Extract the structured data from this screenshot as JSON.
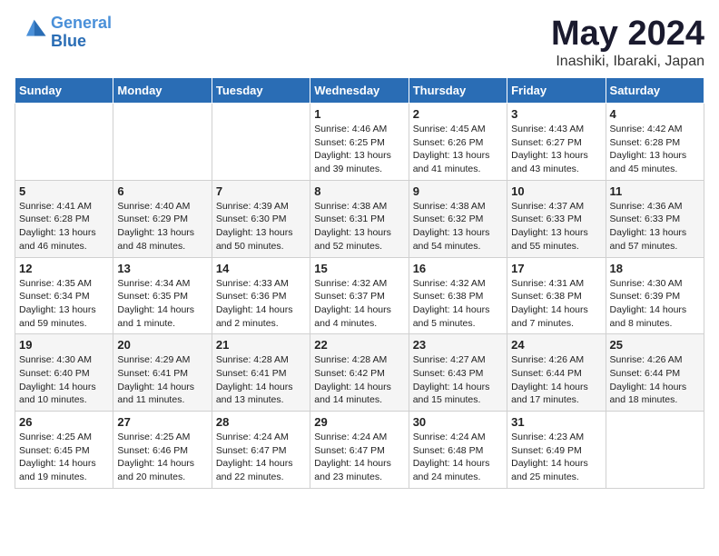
{
  "logo": {
    "line1": "General",
    "line2": "Blue"
  },
  "title": "May 2024",
  "location": "Inashiki, Ibaraki, Japan",
  "days_header": [
    "Sunday",
    "Monday",
    "Tuesday",
    "Wednesday",
    "Thursday",
    "Friday",
    "Saturday"
  ],
  "weeks": [
    [
      {
        "day": "",
        "info": ""
      },
      {
        "day": "",
        "info": ""
      },
      {
        "day": "",
        "info": ""
      },
      {
        "day": "1",
        "info": "Sunrise: 4:46 AM\nSunset: 6:25 PM\nDaylight: 13 hours\nand 39 minutes."
      },
      {
        "day": "2",
        "info": "Sunrise: 4:45 AM\nSunset: 6:26 PM\nDaylight: 13 hours\nand 41 minutes."
      },
      {
        "day": "3",
        "info": "Sunrise: 4:43 AM\nSunset: 6:27 PM\nDaylight: 13 hours\nand 43 minutes."
      },
      {
        "day": "4",
        "info": "Sunrise: 4:42 AM\nSunset: 6:28 PM\nDaylight: 13 hours\nand 45 minutes."
      }
    ],
    [
      {
        "day": "5",
        "info": "Sunrise: 4:41 AM\nSunset: 6:28 PM\nDaylight: 13 hours\nand 46 minutes."
      },
      {
        "day": "6",
        "info": "Sunrise: 4:40 AM\nSunset: 6:29 PM\nDaylight: 13 hours\nand 48 minutes."
      },
      {
        "day": "7",
        "info": "Sunrise: 4:39 AM\nSunset: 6:30 PM\nDaylight: 13 hours\nand 50 minutes."
      },
      {
        "day": "8",
        "info": "Sunrise: 4:38 AM\nSunset: 6:31 PM\nDaylight: 13 hours\nand 52 minutes."
      },
      {
        "day": "9",
        "info": "Sunrise: 4:38 AM\nSunset: 6:32 PM\nDaylight: 13 hours\nand 54 minutes."
      },
      {
        "day": "10",
        "info": "Sunrise: 4:37 AM\nSunset: 6:33 PM\nDaylight: 13 hours\nand 55 minutes."
      },
      {
        "day": "11",
        "info": "Sunrise: 4:36 AM\nSunset: 6:33 PM\nDaylight: 13 hours\nand 57 minutes."
      }
    ],
    [
      {
        "day": "12",
        "info": "Sunrise: 4:35 AM\nSunset: 6:34 PM\nDaylight: 13 hours\nand 59 minutes."
      },
      {
        "day": "13",
        "info": "Sunrise: 4:34 AM\nSunset: 6:35 PM\nDaylight: 14 hours\nand 1 minute."
      },
      {
        "day": "14",
        "info": "Sunrise: 4:33 AM\nSunset: 6:36 PM\nDaylight: 14 hours\nand 2 minutes."
      },
      {
        "day": "15",
        "info": "Sunrise: 4:32 AM\nSunset: 6:37 PM\nDaylight: 14 hours\nand 4 minutes."
      },
      {
        "day": "16",
        "info": "Sunrise: 4:32 AM\nSunset: 6:38 PM\nDaylight: 14 hours\nand 5 minutes."
      },
      {
        "day": "17",
        "info": "Sunrise: 4:31 AM\nSunset: 6:38 PM\nDaylight: 14 hours\nand 7 minutes."
      },
      {
        "day": "18",
        "info": "Sunrise: 4:30 AM\nSunset: 6:39 PM\nDaylight: 14 hours\nand 8 minutes."
      }
    ],
    [
      {
        "day": "19",
        "info": "Sunrise: 4:30 AM\nSunset: 6:40 PM\nDaylight: 14 hours\nand 10 minutes."
      },
      {
        "day": "20",
        "info": "Sunrise: 4:29 AM\nSunset: 6:41 PM\nDaylight: 14 hours\nand 11 minutes."
      },
      {
        "day": "21",
        "info": "Sunrise: 4:28 AM\nSunset: 6:41 PM\nDaylight: 14 hours\nand 13 minutes."
      },
      {
        "day": "22",
        "info": "Sunrise: 4:28 AM\nSunset: 6:42 PM\nDaylight: 14 hours\nand 14 minutes."
      },
      {
        "day": "23",
        "info": "Sunrise: 4:27 AM\nSunset: 6:43 PM\nDaylight: 14 hours\nand 15 minutes."
      },
      {
        "day": "24",
        "info": "Sunrise: 4:26 AM\nSunset: 6:44 PM\nDaylight: 14 hours\nand 17 minutes."
      },
      {
        "day": "25",
        "info": "Sunrise: 4:26 AM\nSunset: 6:44 PM\nDaylight: 14 hours\nand 18 minutes."
      }
    ],
    [
      {
        "day": "26",
        "info": "Sunrise: 4:25 AM\nSunset: 6:45 PM\nDaylight: 14 hours\nand 19 minutes."
      },
      {
        "day": "27",
        "info": "Sunrise: 4:25 AM\nSunset: 6:46 PM\nDaylight: 14 hours\nand 20 minutes."
      },
      {
        "day": "28",
        "info": "Sunrise: 4:24 AM\nSunset: 6:47 PM\nDaylight: 14 hours\nand 22 minutes."
      },
      {
        "day": "29",
        "info": "Sunrise: 4:24 AM\nSunset: 6:47 PM\nDaylight: 14 hours\nand 23 minutes."
      },
      {
        "day": "30",
        "info": "Sunrise: 4:24 AM\nSunset: 6:48 PM\nDaylight: 14 hours\nand 24 minutes."
      },
      {
        "day": "31",
        "info": "Sunrise: 4:23 AM\nSunset: 6:49 PM\nDaylight: 14 hours\nand 25 minutes."
      },
      {
        "day": "",
        "info": ""
      }
    ]
  ]
}
